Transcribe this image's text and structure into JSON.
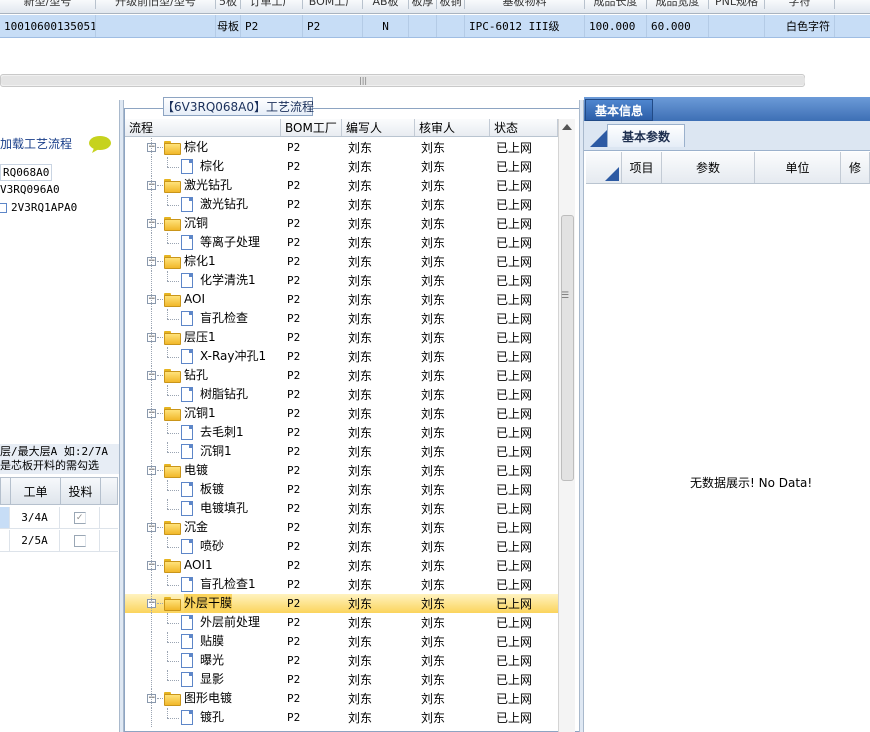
{
  "top_grid": {
    "headers": [
      "新型/型号",
      "升级前旧型/型号",
      "5板",
      "订单工厂",
      "BOM工厂",
      "AB板",
      "板厚",
      "板铜",
      "基板物料",
      "成品长度",
      "成品宽度",
      "PNL规格",
      "字符"
    ],
    "row": [
      "10010600135051",
      "",
      "母板",
      "P2",
      "P2",
      "N",
      "",
      "",
      "IPC-6012 III级",
      "100.000",
      "60.000",
      "",
      "白色字符"
    ]
  },
  "left_panel": {
    "title": "加载工艺流程",
    "tree": [
      "RQ068A0",
      "V3RQ096A0",
      "2V3RQ1APA0"
    ],
    "note_lines": [
      "层/最大层A 如:2/7A",
      "是芯板开料的需勾选"
    ],
    "grid_headers": [
      "",
      "工单",
      "投料"
    ],
    "grid_rows": [
      {
        "order": "3/4A",
        "checked": true
      },
      {
        "order": "2/5A",
        "checked": false
      }
    ]
  },
  "middle_panel": {
    "tab_title": "【6V3RQ068A0】工艺流程",
    "headers": [
      "流程",
      "BOM工厂",
      "编写人",
      "核审人",
      "状态"
    ],
    "rows": [
      {
        "level": 0,
        "name": "棕化",
        "bom": "P2",
        "writer": "刘东",
        "reviewer": "刘东",
        "status": "已上网"
      },
      {
        "level": 1,
        "name": "棕化",
        "bom": "P2",
        "writer": "刘东",
        "reviewer": "刘东",
        "status": "已上网"
      },
      {
        "level": 0,
        "name": "激光钻孔",
        "bom": "P2",
        "writer": "刘东",
        "reviewer": "刘东",
        "status": "已上网"
      },
      {
        "level": 1,
        "name": "激光钻孔",
        "bom": "P2",
        "writer": "刘东",
        "reviewer": "刘东",
        "status": "已上网"
      },
      {
        "level": 0,
        "name": "沉铜",
        "bom": "P2",
        "writer": "刘东",
        "reviewer": "刘东",
        "status": "已上网"
      },
      {
        "level": 1,
        "name": "等离子处理",
        "bom": "P2",
        "writer": "刘东",
        "reviewer": "刘东",
        "status": "已上网"
      },
      {
        "level": 0,
        "name": "棕化1",
        "bom": "P2",
        "writer": "刘东",
        "reviewer": "刘东",
        "status": "已上网"
      },
      {
        "level": 1,
        "name": "化学清洗1",
        "bom": "P2",
        "writer": "刘东",
        "reviewer": "刘东",
        "status": "已上网"
      },
      {
        "level": 0,
        "name": "AOI",
        "bom": "P2",
        "writer": "刘东",
        "reviewer": "刘东",
        "status": "已上网"
      },
      {
        "level": 1,
        "name": "盲孔检查",
        "bom": "P2",
        "writer": "刘东",
        "reviewer": "刘东",
        "status": "已上网"
      },
      {
        "level": 0,
        "name": "层压1",
        "bom": "P2",
        "writer": "刘东",
        "reviewer": "刘东",
        "status": "已上网"
      },
      {
        "level": 1,
        "name": "X-Ray冲孔1",
        "bom": "P2",
        "writer": "刘东",
        "reviewer": "刘东",
        "status": "已上网"
      },
      {
        "level": 0,
        "name": "钻孔",
        "bom": "P2",
        "writer": "刘东",
        "reviewer": "刘东",
        "status": "已上网"
      },
      {
        "level": 1,
        "name": "树脂钻孔",
        "bom": "P2",
        "writer": "刘东",
        "reviewer": "刘东",
        "status": "已上网"
      },
      {
        "level": 0,
        "name": "沉铜1",
        "bom": "P2",
        "writer": "刘东",
        "reviewer": "刘东",
        "status": "已上网"
      },
      {
        "level": 1,
        "name": "去毛刺1",
        "bom": "P2",
        "writer": "刘东",
        "reviewer": "刘东",
        "status": "已上网"
      },
      {
        "level": 1,
        "name": "沉铜1",
        "bom": "P2",
        "writer": "刘东",
        "reviewer": "刘东",
        "status": "已上网"
      },
      {
        "level": 0,
        "name": "电镀",
        "bom": "P2",
        "writer": "刘东",
        "reviewer": "刘东",
        "status": "已上网"
      },
      {
        "level": 1,
        "name": "板镀",
        "bom": "P2",
        "writer": "刘东",
        "reviewer": "刘东",
        "status": "已上网"
      },
      {
        "level": 1,
        "name": "电镀填孔",
        "bom": "P2",
        "writer": "刘东",
        "reviewer": "刘东",
        "status": "已上网"
      },
      {
        "level": 0,
        "name": "沉金",
        "bom": "P2",
        "writer": "刘东",
        "reviewer": "刘东",
        "status": "已上网"
      },
      {
        "level": 1,
        "name": "喷砂",
        "bom": "P2",
        "writer": "刘东",
        "reviewer": "刘东",
        "status": "已上网"
      },
      {
        "level": 0,
        "name": "AOI1",
        "bom": "P2",
        "writer": "刘东",
        "reviewer": "刘东",
        "status": "已上网"
      },
      {
        "level": 1,
        "name": "盲孔检查1",
        "bom": "P2",
        "writer": "刘东",
        "reviewer": "刘东",
        "status": "已上网"
      },
      {
        "level": 0,
        "name": "外层干膜",
        "bom": "P2",
        "writer": "刘东",
        "reviewer": "刘东",
        "status": "已上网",
        "selected": true
      },
      {
        "level": 1,
        "name": "外层前处理",
        "bom": "P2",
        "writer": "刘东",
        "reviewer": "刘东",
        "status": "已上网"
      },
      {
        "level": 1,
        "name": "贴膜",
        "bom": "P2",
        "writer": "刘东",
        "reviewer": "刘东",
        "status": "已上网"
      },
      {
        "level": 1,
        "name": "曝光",
        "bom": "P2",
        "writer": "刘东",
        "reviewer": "刘东",
        "status": "已上网"
      },
      {
        "level": 1,
        "name": "显影",
        "bom": "P2",
        "writer": "刘东",
        "reviewer": "刘东",
        "status": "已上网"
      },
      {
        "level": 0,
        "name": "图形电镀",
        "bom": "P2",
        "writer": "刘东",
        "reviewer": "刘东",
        "status": "已上网"
      },
      {
        "level": 1,
        "name": "镀孔",
        "bom": "P2",
        "writer": "刘东",
        "reviewer": "刘东",
        "status": "已上网"
      }
    ]
  },
  "right_panel": {
    "tab": "基本信息",
    "subtab": "基本参数",
    "headers": [
      "",
      "项目",
      "参数",
      "单位",
      "修"
    ],
    "empty_text": "无数据展示! No Data!"
  },
  "colors": {
    "selection_bg": "#c7ddf6",
    "row_highlight": "#fbd45c",
    "tab_blue": "#2c5ea8"
  }
}
